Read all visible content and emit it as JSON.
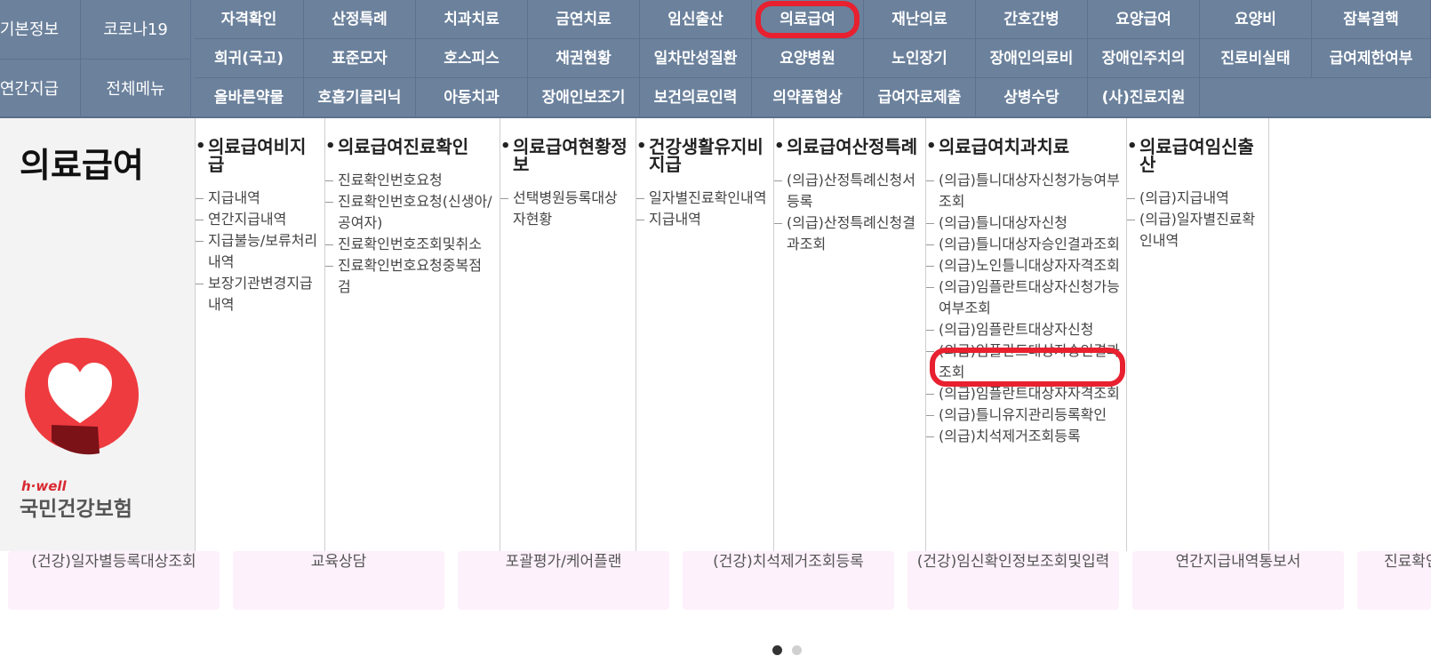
{
  "nav": {
    "left": [
      "기본정보",
      "코로나19",
      "연간지급",
      "전체메뉴"
    ],
    "row1": [
      "자격확인",
      "산정특례",
      "치과치료",
      "금연치료",
      "임신출산",
      "의료급여",
      "재난의료",
      "간호간병",
      "요양급여",
      "요양비",
      "잠복결핵"
    ],
    "row2": [
      "희귀(국고)",
      "표준모자",
      "호스피스",
      "채권현황",
      "일차만성질환",
      "요양병원",
      "노인장기",
      "장애인의료비",
      "장애인주치의",
      "진료비실태",
      "급여제한여부"
    ],
    "row3": [
      "올바른약물",
      "호흡기클리닉",
      "아동치과",
      "장애인보조기",
      "보건의료인력",
      "의약품협상",
      "급여자료제출",
      "상병수당",
      "(사)진료지원"
    ],
    "active": "의료급여"
  },
  "panel": {
    "title": "의료급여",
    "brand_small": "h·well",
    "brand_big": "국민건강보험",
    "columns": [
      {
        "title": "의료급여비지급",
        "items": [
          "지급내역",
          "연간지급내역",
          "지급불능/보류처리내역",
          "보장기관변경지급내역"
        ]
      },
      {
        "title": "의료급여진료확인",
        "items": [
          "진료확인번호요청",
          "진료확인번호요청(신생아/공여자)",
          "진료확인번호조회및취소",
          "진료확인번호요청중복점검"
        ]
      },
      {
        "title": "의료급여현황정보",
        "items": [
          "선택병원등록대상자현황"
        ]
      },
      {
        "title": "건강생활유지비지급",
        "items": [
          "일자별진료확인내역",
          "지급내역"
        ]
      },
      {
        "title": "의료급여산정특례",
        "items": [
          "(의급)산정특례신청서등록",
          "(의급)산정특례신청결과조회"
        ]
      },
      {
        "title": "의료급여치과치료",
        "items": [
          "(의급)틀니대상자신청가능여부조회",
          "(의급)틀니대상자신청",
          "(의급)틀니대상자승인결과조회",
          "(의급)노인틀니대상자자격조회",
          "(의급)임플란트대상자신청가능여부조회",
          "(의급)임플란트대상자신청",
          "(의급)임플란트대상자승인결과조회",
          "(의급)임플란트대상자자격조회",
          "(의급)틀니유지관리등록확인",
          "(의급)치석제거조회등록"
        ]
      },
      {
        "title": "의료급여임신출산",
        "items": [
          "(의급)지급내역",
          "(의급)일자별진료확인내역"
        ]
      }
    ],
    "highlighted_item": "(의급)임플란트대상자신청"
  },
  "carousel": {
    "cards": [
      "(건강)일자별등록대상조회",
      "교육상담",
      "포괄평가/케어플랜",
      "(건강)치석제거조회등록",
      "(건강)임신확인정보조회및입력",
      "연간지급내역통보서",
      "진료확인"
    ]
  },
  "colors": {
    "nav_bg": "#6b819c",
    "highlight": "#e8202f",
    "card_bg": "#fdf1fb",
    "logo_red": "#ee3b3f"
  }
}
